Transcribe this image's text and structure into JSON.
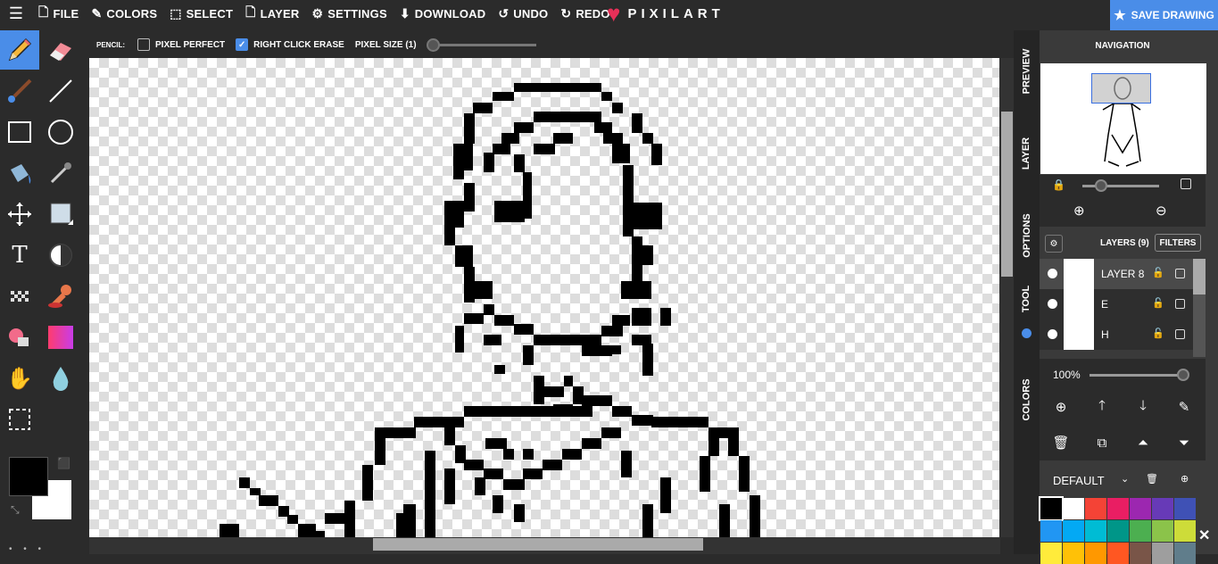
{
  "topbar": {
    "menu_icon": "hamburger-icon",
    "items": [
      {
        "label": "FILE",
        "icon": "file-icon"
      },
      {
        "label": "COLORS",
        "icon": "brush-icon"
      },
      {
        "label": "SELECT",
        "icon": "select-icon"
      },
      {
        "label": "LAYER",
        "icon": "layer-icon"
      },
      {
        "label": "SETTINGS",
        "icon": "gears-icon"
      },
      {
        "label": "DOWNLOAD",
        "icon": "download-icon"
      },
      {
        "label": "UNDO",
        "icon": "undo-icon"
      },
      {
        "label": "REDO",
        "icon": "redo-icon"
      }
    ],
    "logo_text": "PIXILART",
    "save_label": "SAVE DRAWING",
    "accent": "#4a8de8"
  },
  "options": {
    "tool_label": "PENCIL:",
    "pixel_perfect_label": "PIXEL PERFECT",
    "pixel_perfect_checked": false,
    "right_click_erase_label": "RIGHT CLICK ERASE",
    "right_click_erase_checked": true,
    "pixel_size_label": "PIXEL SIZE (1)"
  },
  "tools": [
    "pencil-icon",
    "eraser-icon",
    "brush-icon",
    "line-icon",
    "rectangle-icon",
    "circle-icon",
    "bucket-icon",
    "eyedropper-icon",
    "move-icon",
    "shade-icon",
    "text-icon",
    "dither-icon",
    "pattern-icon",
    "stamp-icon",
    "eraser-fill-icon",
    "gradient-icon",
    "hand-icon",
    "drop-icon",
    "select-rect-icon"
  ],
  "colors": {
    "primary": "#000000",
    "secondary": "#ffffff"
  },
  "sidetabs": [
    "PREVIEW",
    "LAYER",
    "OPTIONS",
    "TOOL",
    "COLORS"
  ],
  "navigation": {
    "title": "NAVIGATION"
  },
  "layers": {
    "title": "LAYERS (9)",
    "filters_label": "FILTERS",
    "items": [
      {
        "name": "LAYER 8",
        "active": true
      },
      {
        "name": "E",
        "active": false
      },
      {
        "name": "H",
        "active": false
      }
    ],
    "opacity": "100%"
  },
  "palette": {
    "name": "DEFAULT",
    "colors": [
      "#000000",
      "#ffffff",
      "#f44336",
      "#e91e63",
      "#9c27b0",
      "#673ab7",
      "#3f51b5",
      "#2196f3",
      "#03a9f4",
      "#00bcd4",
      "#009688",
      "#4caf50",
      "#8bc34a",
      "#cddc39",
      "#ffeb3b",
      "#ffc107",
      "#ff9800",
      "#ff5722",
      "#795548",
      "#9e9e9e",
      "#607d8b"
    ]
  }
}
